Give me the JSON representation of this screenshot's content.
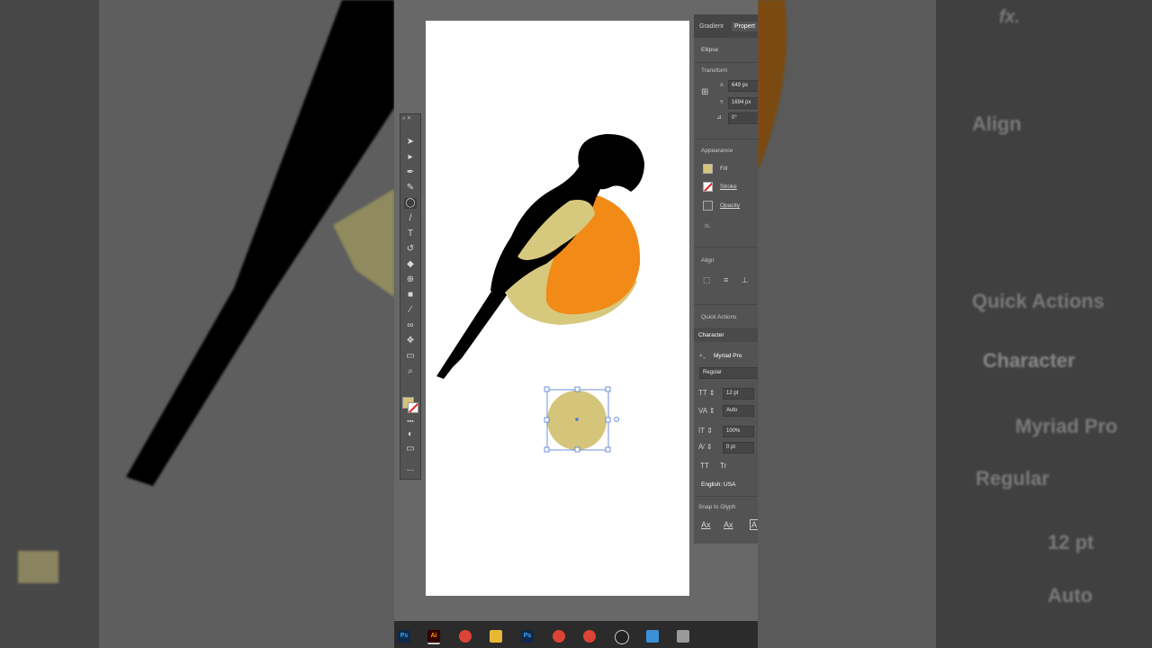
{
  "panel": {
    "tabs": [
      "Gradient",
      "Propert"
    ],
    "object_type": "Ellipse",
    "transform": {
      "heading": "Transform",
      "x_label": "X:",
      "x_value": "649 px",
      "y_label": "Y:",
      "y_value": "1694 px",
      "angle_value": "0°"
    },
    "appearance": {
      "heading": "Appearance",
      "fill": "Fill",
      "stroke": "Stroke",
      "opacity": "Opacity",
      "fx": "fx."
    },
    "align": {
      "heading": "Align"
    },
    "quick_actions": {
      "heading": "Quick Actions"
    },
    "character": {
      "heading": "Character",
      "font": "Myriad Pro",
      "style": "Regular",
      "size": "12 pt",
      "leading": "Auto",
      "scale": "100%",
      "tracking": "0 pt",
      "tt_upper": "TT",
      "tt_small": "Tr",
      "language": "English: USA"
    },
    "snap_to_glyph": {
      "heading": "Snap to Glyph",
      "glyphs": [
        "Ax",
        "Ax",
        "A"
      ]
    }
  },
  "background_zoom": {
    "fx": "fx.",
    "align": "Align",
    "quick_actions": "Quick Actions",
    "character": "Character",
    "font": "Myriad Pro",
    "style": "Regular",
    "size": "12 pt",
    "leading": "Auto"
  },
  "toolbar": {
    "tools": [
      "selection-tool",
      "direct-selection-tool",
      "pen-tool",
      "curvature-tool",
      "ellipse-tool",
      "paintbrush-tool",
      "type-tool",
      "rotate-tool",
      "eraser-tool",
      "shape-builder-tool",
      "gradient-tool",
      "eyedropper-tool",
      "blend-tool",
      "symbol-sprayer-tool",
      "artboard-tool",
      "zoom-tool"
    ],
    "more": "..."
  },
  "taskbar": {
    "apps": [
      "Ps",
      "Ai",
      "chrome",
      "files",
      "Ps",
      "chrome",
      "chrome",
      "obs",
      "settings",
      "calculator"
    ]
  },
  "colors": {
    "fill": "#d4c57a",
    "bird_black": "#000000",
    "bird_orange": "#f28a18",
    "bird_khaki": "#d6c97e",
    "selection_blue": "#4b78d6"
  }
}
